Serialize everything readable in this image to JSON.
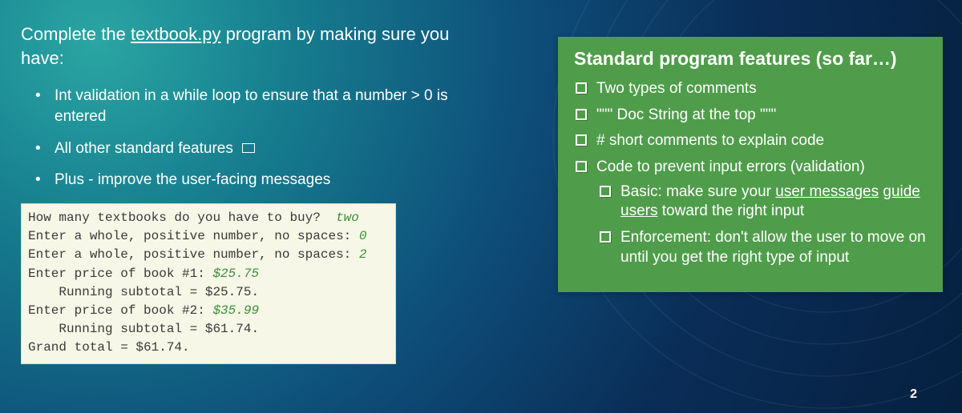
{
  "intro": {
    "prefix": "Complete the ",
    "filename": "textbook.py",
    "suffix": " program by making sure you have:"
  },
  "bullets": [
    "Int validation in a while loop to ensure that a number > 0 is entered",
    "All other standard features",
    "Plus - improve the user-facing messages"
  ],
  "console": {
    "l1_prompt": "How many textbooks do you have to buy?  ",
    "l1_input": "two",
    "l2_prompt": "Enter a whole, positive number, no spaces: ",
    "l2_input": "0",
    "l3_prompt": "Enter a whole, positive number, no spaces: ",
    "l3_input": "2",
    "l4_prompt": "Enter price of book #1: ",
    "l4_input": "$25.75",
    "l5": "    Running subtotal = $25.75.",
    "l6_prompt": "Enter price of book #2: ",
    "l6_input": "$35.99",
    "l7": "    Running subtotal = $61.74.",
    "l8": "Grand total = $61.74."
  },
  "panel": {
    "title": "Standard program features (so far…)",
    "items": {
      "a": "Two types of comments",
      "b": "\"\"\" Doc String at the top \"\"\"",
      "c": "# short comments to explain code",
      "d": "Code to prevent input errors (validation)",
      "e_prefix": "Basic: make sure your ",
      "e_um1": "user messages",
      "e_mid": " ",
      "e_um2": "guide users",
      "e_suffix": " toward the right input",
      "f": "Enforcement: don't allow the user to move on until you get the right type of input"
    }
  },
  "page_number": "2"
}
